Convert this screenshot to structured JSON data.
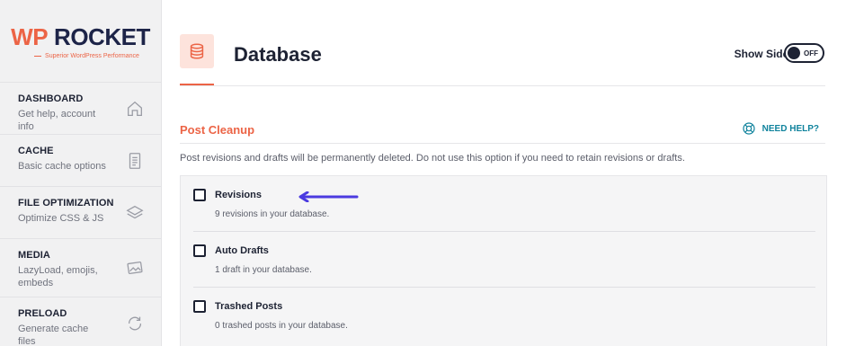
{
  "logo": {
    "wp": "WP",
    "rocket": "ROCKET",
    "tagline": "Superior WordPress Performance"
  },
  "sidebar": {
    "items": [
      {
        "title": "DASHBOARD",
        "desc": "Get help, account info",
        "icon": "home-icon"
      },
      {
        "title": "CACHE",
        "desc": "Basic cache options",
        "icon": "document-icon"
      },
      {
        "title": "FILE OPTIMIZATION",
        "desc": "Optimize CSS & JS",
        "icon": "layers-icon"
      },
      {
        "title": "MEDIA",
        "desc": "LazyLoad, emojis, embeds",
        "icon": "image-icon"
      },
      {
        "title": "PRELOAD",
        "desc": "Generate cache files",
        "icon": "refresh-icon"
      }
    ]
  },
  "header": {
    "title": "Database",
    "icon": "database-icon",
    "show_sidebar_label": "Show Sidebar",
    "toggle_state": "OFF"
  },
  "section": {
    "title": "Post Cleanup",
    "help_label": "NEED HELP?",
    "description": "Post revisions and drafts will be permanently deleted. Do not use this option if you need to retain revisions or drafts."
  },
  "options": [
    {
      "label": "Revisions",
      "sub": "9 revisions in your database.",
      "checked": false
    },
    {
      "label": "Auto Drafts",
      "sub": "1 draft in your database.",
      "checked": false
    },
    {
      "label": "Trashed Posts",
      "sub": "0 trashed posts in your database.",
      "checked": false
    }
  ],
  "colors": {
    "accent": "#ec6446",
    "help": "#10839d",
    "arrow": "#4b3be0",
    "dark": "#1d2233"
  }
}
